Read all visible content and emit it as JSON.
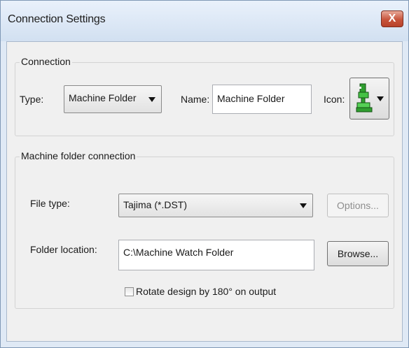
{
  "window": {
    "title": "Connection Settings",
    "close_glyph": "X"
  },
  "connection_group": {
    "legend": "Connection",
    "type_label": "Type:",
    "type_value": "Machine Folder",
    "name_label": "Name:",
    "name_value": "Machine Folder",
    "icon_label": "Icon:",
    "icon_name": "embroidery-machine-icon"
  },
  "machine_folder_group": {
    "legend": "Machine folder connection",
    "file_type_label": "File type:",
    "file_type_value": "Tajima (*.DST)",
    "options_button": "Options...",
    "folder_location_label": "Folder location:",
    "folder_location_value": "C:\\Machine Watch Folder",
    "browse_button": "Browse...",
    "rotate_label": "Rotate design by 180° on output",
    "rotate_checked": false
  },
  "colors": {
    "machine_icon": "#2f9e2f",
    "close_button": "#c7543b"
  }
}
